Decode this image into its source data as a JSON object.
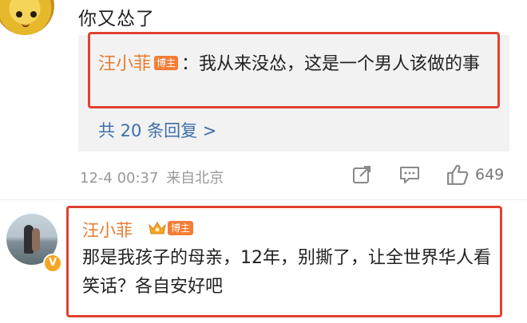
{
  "top_comment": {
    "text": "你又怂了"
  },
  "reply": {
    "author": "汪小菲",
    "badge": "博主",
    "separator": "：",
    "text": "我从来没怂，这是一个男人该做的事",
    "view_replies": "共 20 条回复 >"
  },
  "meta": {
    "timestamp": "12-4 00:37",
    "location": "来自北京",
    "like_count": "649"
  },
  "comment2": {
    "author": "汪小菲",
    "badge": "博主",
    "text": "那是我孩子的母亲，12年，别撕了，让全世界华人看笑话？各自安好吧"
  },
  "icons": {
    "share": "share-icon",
    "comment": "comment-icon",
    "like": "thumbs-up-icon",
    "verified": "verified-v-icon",
    "crown": "crown-icon"
  },
  "colors": {
    "name": "#e67b30",
    "badge": "#f47d36",
    "link": "#3d6fa8",
    "highlight_box": "#e0412f",
    "meta": "#999999"
  }
}
